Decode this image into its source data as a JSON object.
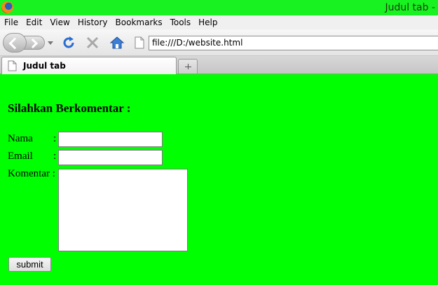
{
  "window": {
    "title": "Judul tab -"
  },
  "menu": {
    "items": [
      "File",
      "Edit",
      "View",
      "History",
      "Bookmarks",
      "Tools",
      "Help"
    ]
  },
  "nav": {
    "url": "file:///D:/website.html"
  },
  "tabs": [
    {
      "label": "Judul tab"
    }
  ],
  "form": {
    "heading": "Silahkan Berkomentar :",
    "nama_label": "Nama",
    "email_label": "Email",
    "komentar_label": "Komentar :",
    "colon": ":",
    "nama_value": "",
    "email_value": "",
    "komentar_value": "",
    "submit_label": "submit"
  },
  "colors": {
    "page_background": "#00ff00",
    "titlebar": "#18f220"
  },
  "icons": [
    "firefox-icon",
    "back-icon",
    "forward-icon",
    "reload-icon",
    "stop-icon",
    "home-icon",
    "page-icon",
    "new-tab-icon"
  ]
}
